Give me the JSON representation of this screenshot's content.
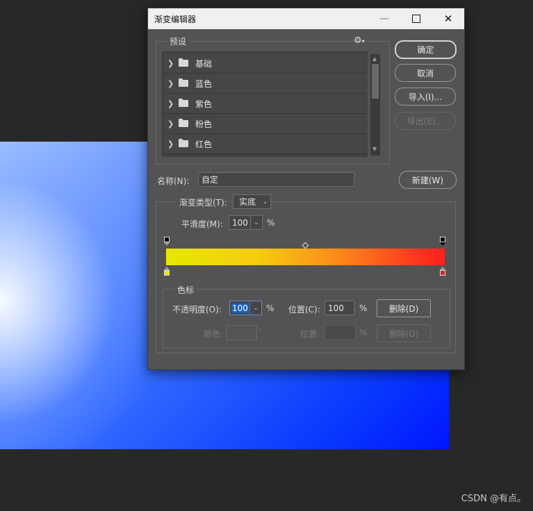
{
  "watermark": "CSDN @有点。",
  "dialog": {
    "title": "渐变编辑器",
    "minimize_glyph": "—",
    "maximize_glyph": "☐",
    "close_glyph": "✕"
  },
  "presets": {
    "legend": "预设",
    "gear_glyph": "⚙",
    "items": [
      {
        "label": "基础"
      },
      {
        "label": "蓝色"
      },
      {
        "label": "紫色"
      },
      {
        "label": "粉色"
      },
      {
        "label": "红色"
      }
    ]
  },
  "buttons": {
    "ok": "确定",
    "cancel": "取消",
    "import": "导入(I)...",
    "export": "导出(E)...",
    "new": "新建(W)"
  },
  "name_row": {
    "label": "名称(N):",
    "value": "自定"
  },
  "gradient": {
    "type_label": "渐变类型(T):",
    "type_value": "实底",
    "smoothness_label": "平滑度(M):",
    "smoothness_value": "100",
    "smoothness_unit": "%",
    "colors": {
      "start": "#e6e800",
      "end": "#fb201e"
    }
  },
  "color_stops": {
    "legend": "色标",
    "opacity_label": "不透明度(O):",
    "opacity_value": "100",
    "opacity_unit": "%",
    "position_label": "位置(C):",
    "position_value": "100",
    "position_unit": "%",
    "delete_label": "删除(D)",
    "color_label": "颜色:",
    "color_position_label": "位置:",
    "color_position_unit": "%",
    "color_delete_label": "删除(D)"
  }
}
